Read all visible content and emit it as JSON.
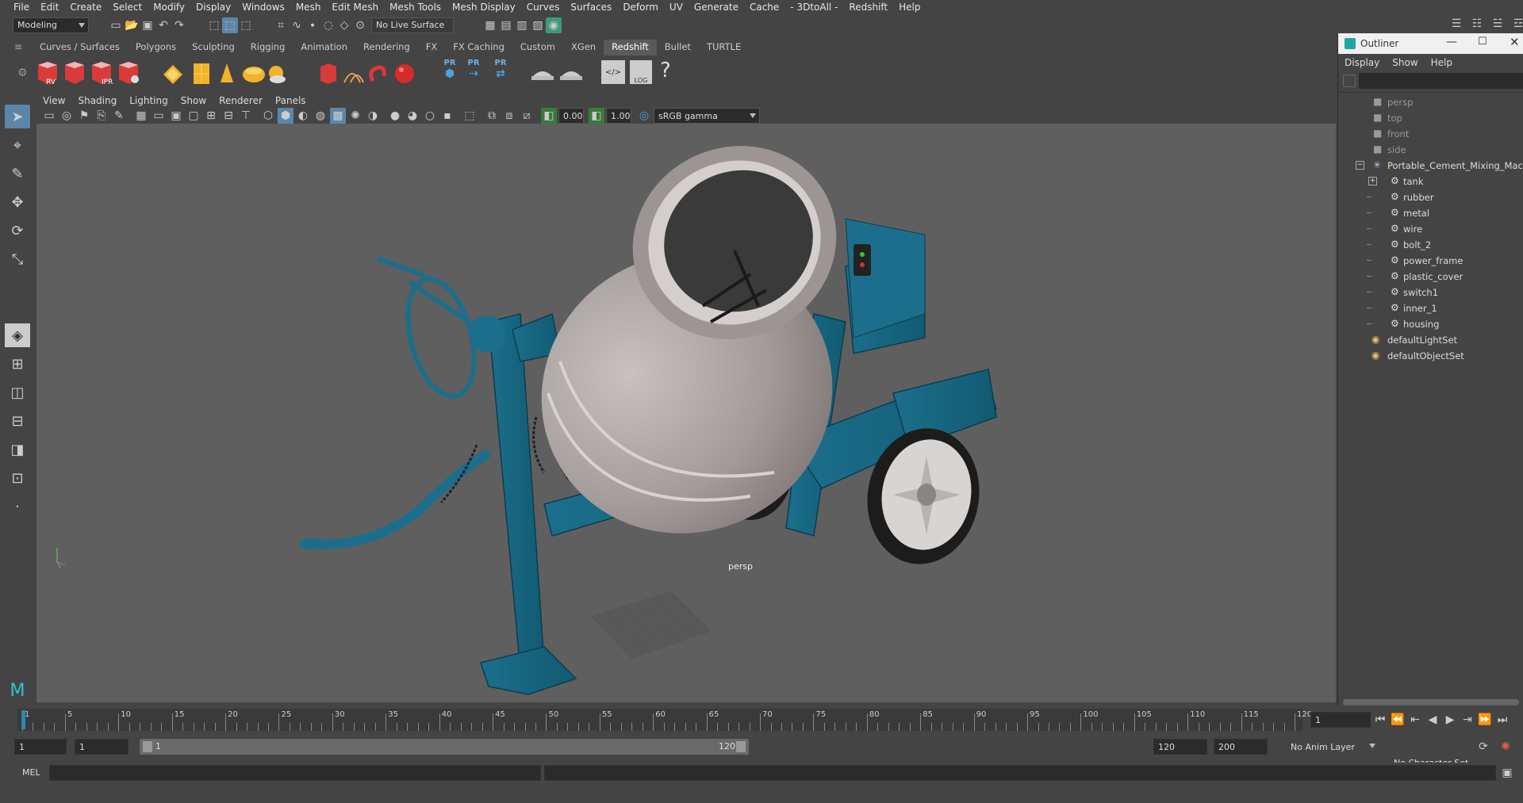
{
  "menubar": {
    "items": [
      "File",
      "Edit",
      "Create",
      "Select",
      "Modify",
      "Display",
      "Windows",
      "Mesh",
      "Edit Mesh",
      "Mesh Tools",
      "Mesh Display",
      "Curves",
      "Surfaces",
      "Deform",
      "UV",
      "Generate",
      "Cache",
      "- 3DtoAll -",
      "Redshift",
      "Help"
    ]
  },
  "statusline": {
    "menuset": "Modeling",
    "live_surface": "No Live Surface"
  },
  "shelf_tabs": [
    "Curves / Surfaces",
    "Polygons",
    "Sculpting",
    "Rigging",
    "Animation",
    "Rendering",
    "FX",
    "FX Caching",
    "Custom",
    "XGen",
    "Redshift",
    "Bullet",
    "TURTLE"
  ],
  "shelf_active": "Redshift",
  "shelf_labels": {
    "rv": "RV",
    "ipr": "IPR",
    "pr1": "PR",
    "pr2": "PR",
    "pr3": "PR",
    "log": "LOG",
    "help": "?"
  },
  "panel_menu": [
    "View",
    "Shading",
    "Lighting",
    "Show",
    "Renderer",
    "Panels"
  ],
  "panel_toolbar": {
    "exposure": "0.00",
    "gamma": "1.00",
    "colorspace": "sRGB gamma"
  },
  "viewport": {
    "camera_label": "persp"
  },
  "outliner": {
    "title": "Outliner",
    "menus": [
      "Display",
      "Show",
      "Help"
    ],
    "cameras": [
      "persp",
      "top",
      "front",
      "side"
    ],
    "root": "Portable_Cement_Mixing_Machine",
    "children": [
      "tank",
      "rubber",
      "metal",
      "wire",
      "bolt_2",
      "power_frame",
      "plastic_cover",
      "switch1",
      "inner_1",
      "housing"
    ],
    "sets": [
      "defaultLightSet",
      "defaultObjectSet"
    ]
  },
  "timeline": {
    "ticks": [
      "1",
      "5",
      "10",
      "15",
      "20",
      "25",
      "30",
      "35",
      "40",
      "45",
      "50",
      "55",
      "60",
      "65",
      "70",
      "75",
      "80",
      "85",
      "90",
      "95",
      "100",
      "105",
      "110",
      "115",
      "120"
    ],
    "current_frame": "1"
  },
  "range": {
    "start": "1",
    "playback_start": "1",
    "slider_start": "1",
    "slider_end": "120",
    "playback_end": "120",
    "end": "200",
    "anim_layer": "No Anim Layer",
    "character_set": "No Character Set"
  },
  "cmdline": {
    "label": "MEL"
  },
  "colors": {
    "accent": "#1a6e8a",
    "tank": "#a8a09e"
  }
}
